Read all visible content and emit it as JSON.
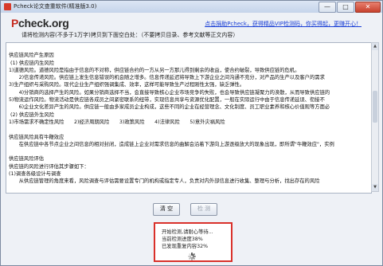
{
  "window": {
    "title": "Pcheck论文查重软件(精准版3.0)",
    "controls": [
      "—",
      "□",
      "✕"
    ]
  },
  "header": {
    "logo_prefix": "P",
    "logo_rest": "check.org",
    "links": "点击捐助Pcheck，获得精品VIP检测码，你买得起，更赚开心！",
    "instruction": "请将检测内容(不多于1万字)拷贝到下面空白处：（不要拷贝目录、参考文献等正文内容）"
  },
  "editor": {
    "lines": [
      "",
      "供应链风险产生原因",
      " (1) 供应链内生风险",
      "1)道德风险。道德风险是指由于信息的不对称，供应链合约的一方从另一方那儿得到剩余的收益，使合约破裂，导致供应链的危机。",
      "　　2)信息传递风险。供应链上发生信息错误的机会随之增多。信息传递延迟将导致上下游企业之间沟通不充分，对产品的生产以及客户的需求",
      "3)生产组织与采购风险。现代企业生产组织强调集成、效率，这样可能导致生产过程刚性太强，缺乏弹性。",
      "　　4)分销商的选择产生的风险。如果分销商选择不当，会直接导致核心企业市场竞争的失败，也会导致供应链凝聚力的涣散，从而导致供应链的",
      "5)物流运作风险。物流活动是供应链各成员之间紧密联系的纽带，实现信息共享与资源优化配置，一般在实际运行中由于信息传递延误、衔接不",
      "　　6)企业文化差异产生的风险。供应链一般由多家成员企业构成，这些不同的企业在经营理念、文化制度、员工职业素养和核心价值观等方面必",
      " (2) 供应链外生风险",
      "1)市场需求不确定性风险　　2)经济周期风险　　3)政策风险　　4)法律风险　　5)意外灾祸风险",
      "",
      "供应链风险具有牛鞭效应",
      "　　在供应链中各节点企业之间信息的相对封闭，造成链上企业对需求信息的曲解会沿着下游向上游逐级放大的现象出现，即所谓\"牛鞭效应\"，实例",
      "",
      "供应链风险评估",
      "供应链的风险进行评估其步骤如下：",
      "(1)调查各级设计与调查",
      "　　从供应链管理的角度来看，风险调查与评估需要设置专门的机构或指定专人，负责对内外部信息进行收集、整理与分析，找出存在的风险"
    ]
  },
  "buttons": {
    "clear": "清 空",
    "check": "检 测"
  },
  "progress": {
    "line1": "开始检测,请耐心等待...",
    "line2": "当前检测进度38%",
    "line3": "已发现重复内容32%",
    "progress_percent": 38,
    "duplicate_percent": 32
  },
  "colors": {
    "link": "#1a3fd6",
    "logo_accent": "#c62b20",
    "highlight_border": "#d9302a"
  }
}
